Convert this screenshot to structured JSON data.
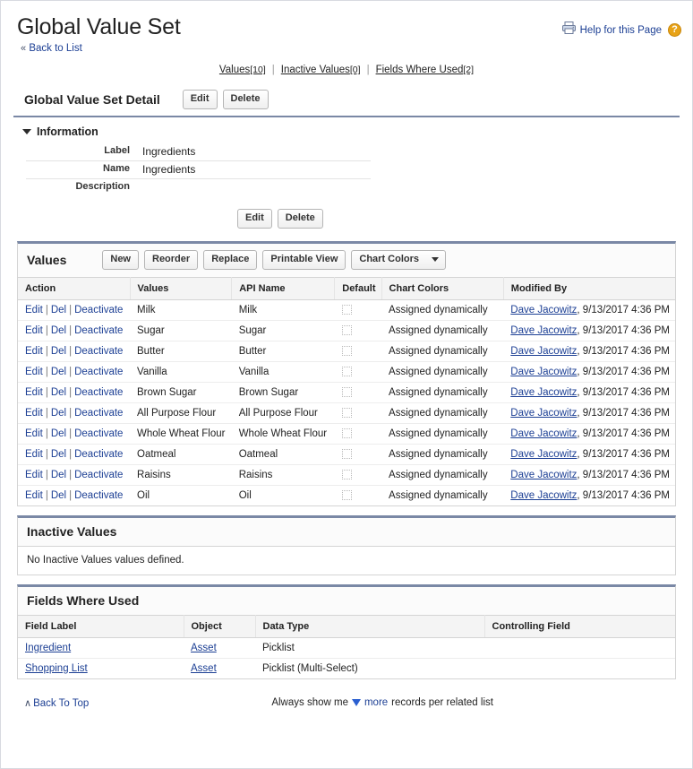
{
  "header": {
    "title": "Global Value Set",
    "help_link": "Help for this Page",
    "help_badge": "?",
    "back_to_list": "Back to List",
    "back_chevron": "«",
    "printer_icon": "printer-icon"
  },
  "related_nav": [
    {
      "label": "Values",
      "count": "[10]"
    },
    {
      "label": "Inactive Values",
      "count": "[0]"
    },
    {
      "label": "Fields Where Used",
      "count": "[2]"
    }
  ],
  "detail": {
    "title": "Global Value Set Detail",
    "edit_label": "Edit",
    "delete_label": "Delete",
    "section_label": "Information",
    "fields": [
      {
        "label": "Label",
        "value": "Ingredients"
      },
      {
        "label": "Name",
        "value": "Ingredients"
      },
      {
        "label": "Description",
        "value": ""
      }
    ],
    "footer_edit_label": "Edit",
    "footer_delete_label": "Delete"
  },
  "values_list": {
    "title": "Values",
    "buttons": [
      "New",
      "Reorder",
      "Replace",
      "Printable View"
    ],
    "dropdown_label": "Chart Colors",
    "columns": [
      "Action",
      "Values",
      "API Name",
      "Default",
      "Chart Colors",
      "Modified By"
    ],
    "action_links": [
      "Edit",
      "Del",
      "Deactivate"
    ],
    "rows": [
      {
        "value": "Milk",
        "api_name": "Milk",
        "default": false,
        "chart_colors": "Assigned dynamically",
        "modified_by": "Dave Jacowitz",
        "modified_date": ", 9/13/2017 4:36 PM"
      },
      {
        "value": "Sugar",
        "api_name": "Sugar",
        "default": false,
        "chart_colors": "Assigned dynamically",
        "modified_by": "Dave Jacowitz",
        "modified_date": ", 9/13/2017 4:36 PM"
      },
      {
        "value": "Butter",
        "api_name": "Butter",
        "default": false,
        "chart_colors": "Assigned dynamically",
        "modified_by": "Dave Jacowitz",
        "modified_date": ", 9/13/2017 4:36 PM"
      },
      {
        "value": "Vanilla",
        "api_name": "Vanilla",
        "default": false,
        "chart_colors": "Assigned dynamically",
        "modified_by": "Dave Jacowitz",
        "modified_date": ", 9/13/2017 4:36 PM"
      },
      {
        "value": "Brown Sugar",
        "api_name": "Brown Sugar",
        "default": false,
        "chart_colors": "Assigned dynamically",
        "modified_by": "Dave Jacowitz",
        "modified_date": ", 9/13/2017 4:36 PM"
      },
      {
        "value": "All Purpose Flour",
        "api_name": "All Purpose Flour",
        "default": false,
        "chart_colors": "Assigned dynamically",
        "modified_by": "Dave Jacowitz",
        "modified_date": ", 9/13/2017 4:36 PM"
      },
      {
        "value": "Whole Wheat Flour",
        "api_name": "Whole Wheat Flour",
        "default": false,
        "chart_colors": "Assigned dynamically",
        "modified_by": "Dave Jacowitz",
        "modified_date": ", 9/13/2017 4:36 PM"
      },
      {
        "value": "Oatmeal",
        "api_name": "Oatmeal",
        "default": false,
        "chart_colors": "Assigned dynamically",
        "modified_by": "Dave Jacowitz",
        "modified_date": ", 9/13/2017 4:36 PM"
      },
      {
        "value": "Raisins",
        "api_name": "Raisins",
        "default": false,
        "chart_colors": "Assigned dynamically",
        "modified_by": "Dave Jacowitz",
        "modified_date": ", 9/13/2017 4:36 PM"
      },
      {
        "value": "Oil",
        "api_name": "Oil",
        "default": false,
        "chart_colors": "Assigned dynamically",
        "modified_by": "Dave Jacowitz",
        "modified_date": ", 9/13/2017 4:36 PM"
      }
    ]
  },
  "inactive_values": {
    "title": "Inactive Values",
    "empty_message": "No Inactive Values values defined."
  },
  "fields_where_used": {
    "title": "Fields Where Used",
    "columns": [
      "Field Label",
      "Object",
      "Data Type",
      "Controlling Field"
    ],
    "rows": [
      {
        "field_label": "Ingredient",
        "object": "Asset",
        "data_type": "Picklist",
        "controlling_field": ""
      },
      {
        "field_label": "Shopping List",
        "object": "Asset",
        "data_type": "Picklist (Multi-Select)",
        "controlling_field": ""
      }
    ]
  },
  "footer": {
    "back_to_top": "Back To Top",
    "up_chevron": "∧",
    "show_prefix": "Always show me",
    "show_link": "more",
    "show_suffix": "records per related list"
  },
  "colors": {
    "link": "#1c3f94",
    "section_border": "#7a88a5",
    "help_badge": "#e8a317"
  }
}
